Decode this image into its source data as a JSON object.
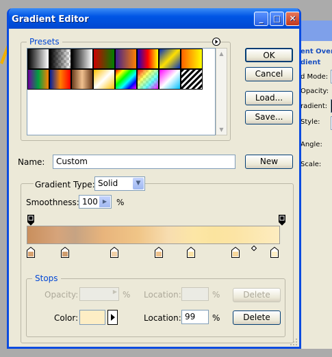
{
  "window": {
    "title": "Gradient Editor",
    "minimize_glyph": "_",
    "maximize_glyph": "□",
    "close_glyph": "✕"
  },
  "presets": {
    "label": "Presets",
    "menu_icon": "circle-arrow-right-icon",
    "swatches": [
      "linear-gradient(90deg,#000,#fff)",
      "checker-black",
      "linear-gradient(90deg,#000,#fff)",
      "linear-gradient(90deg,#d00000,#008000)",
      "linear-gradient(90deg,#402090,#ff8000)",
      "linear-gradient(90deg,#2000c0,#ff0000,#ffff00)",
      "linear-gradient(135deg,#0030c0,#ffe000,#0030c0)",
      "linear-gradient(90deg,#ff6000,#ffff00)",
      "linear-gradient(90deg,#7000a0,#00a040,#ff8000)",
      "linear-gradient(90deg,#0020a0,#ff8000,#ff0000)",
      "linear-gradient(90deg,#6a3a1a,#f0c090,#6a3a1a)",
      "linear-gradient(135deg,#ffc000,#fff,#ffc000)",
      "linear-gradient(135deg,#ff0000,#ffff00,#00ff00,#00ffff,#0000ff,#ff00ff)",
      "checker-rainbow",
      "linear-gradient(135deg,#ff00ff,#ffffff,#00c0ff)",
      "stripes"
    ]
  },
  "buttons": {
    "ok": "OK",
    "cancel": "Cancel",
    "load": "Load...",
    "save": "Save...",
    "new": "New",
    "delete_disabled": "Delete",
    "delete": "Delete"
  },
  "name": {
    "label": "Name:",
    "value": "Custom"
  },
  "gradient_type": {
    "label": "Gradient Type:",
    "value": "Solid"
  },
  "smoothness": {
    "label": "Smoothness:",
    "value": "100",
    "unit": "%"
  },
  "gradient": {
    "css": "linear-gradient(90deg,#c98f5d 0%,#d6a47b 12%,#c6a383 19%,#e8b47c 30%,#f0c587 44%,#f7ddb0 56%,#fce6a6 66%,#fbe49f 74%,#fce4a4 82%,#fdecc0 100%)",
    "color_stops": [
      {
        "pos": 0.0,
        "color": "#d7a26f"
      },
      {
        "pos": 0.14,
        "color": "#cf9d6f"
      },
      {
        "pos": 0.34,
        "color": "#f1d0a7"
      },
      {
        "pos": 0.52,
        "color": "#eec18a"
      },
      {
        "pos": 0.65,
        "color": "#fbe2a5"
      },
      {
        "pos": 0.83,
        "color": "#f7d79b"
      },
      {
        "pos": 0.99,
        "color": "#fdeec5"
      }
    ],
    "midpoint": 0.91
  },
  "stops": {
    "label": "Stops",
    "opacity_label": "Opacity:",
    "opacity_unit": "%",
    "location_label_1": "Location:",
    "location_unit_1": "%",
    "color_label": "Color:",
    "color_value": "#fdeec5",
    "location_label_2": "Location:",
    "location_value": "99",
    "location_unit_2": "%"
  },
  "background_panel": {
    "labels": [
      "ent Overl",
      "dient",
      "d Mode:",
      "Opacity:",
      "radient:",
      "Style:",
      "Angle:",
      "Scale:"
    ]
  }
}
